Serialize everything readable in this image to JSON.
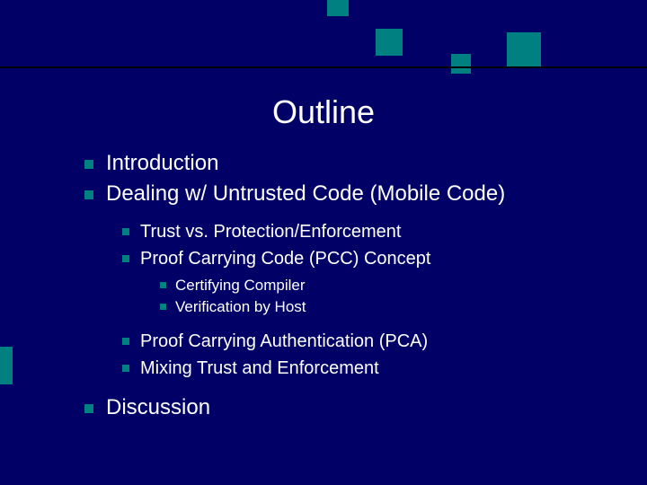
{
  "title": "Outline",
  "items": {
    "intro": "Introduction",
    "dealing": "Dealing w/ Untrusted Code (Mobile Code)",
    "trust": "Trust vs. Protection/Enforcement",
    "pcc": "Proof Carrying Code (PCC) Concept",
    "certifying": "Certifying Compiler",
    "verification": "Verification by Host",
    "pca": "Proof Carrying Authentication (PCA)",
    "mixing": "Mixing Trust and Enforcement",
    "discussion": "Discussion"
  }
}
